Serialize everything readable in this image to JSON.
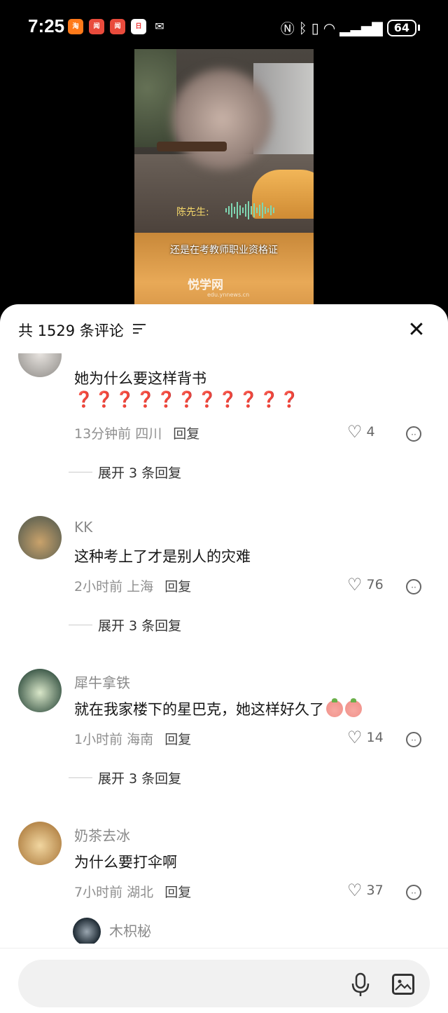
{
  "status_bar": {
    "time": "7:25",
    "battery": "64",
    "app_icons": [
      "taobao-icon",
      "news-icon",
      "news-icon",
      "calendar-icon",
      "mail-icon"
    ],
    "system_icons": [
      "nfc-icon",
      "bluetooth-icon",
      "vibrate-icon",
      "wifi-icon",
      "signal-icon",
      "battery-icon"
    ]
  },
  "video": {
    "speaker_label": "陈先生:",
    "subtitle": "还是在考教师职业资格证",
    "watermark": "悦学网",
    "watermark_sub": "edu.ynnews.cn"
  },
  "sheet": {
    "header": {
      "comment_count": "共 1529 条评论"
    },
    "comments": [
      {
        "author": "",
        "text": "她为什么要这样背书",
        "extra": "❓❓❓❓❓❓❓❓❓❓❓",
        "time": "13分钟前",
        "location": "四川",
        "reply_label": "回复",
        "likes": "4",
        "expand_label": "展开 3 条回复"
      },
      {
        "author": "KK",
        "text": "这种考上了才是别人的灾难",
        "time": "2小时前",
        "location": "上海",
        "reply_label": "回复",
        "likes": "76",
        "expand_label": "展开 3 条回复"
      },
      {
        "author": "犀牛拿铁",
        "text": "就在我家楼下的星巴克，她这样好久了",
        "time": "1小时前",
        "location": "海南",
        "reply_label": "回复",
        "likes": "14",
        "expand_label": "展开 3 条回复"
      },
      {
        "author": "奶茶去冰",
        "text": "为什么要打伞啊",
        "time": "7小时前",
        "location": "湖北",
        "reply_label": "回复",
        "likes": "37"
      }
    ],
    "sub_reply_author": "木枳柲"
  },
  "input_bar": {
    "placeholder": ""
  }
}
